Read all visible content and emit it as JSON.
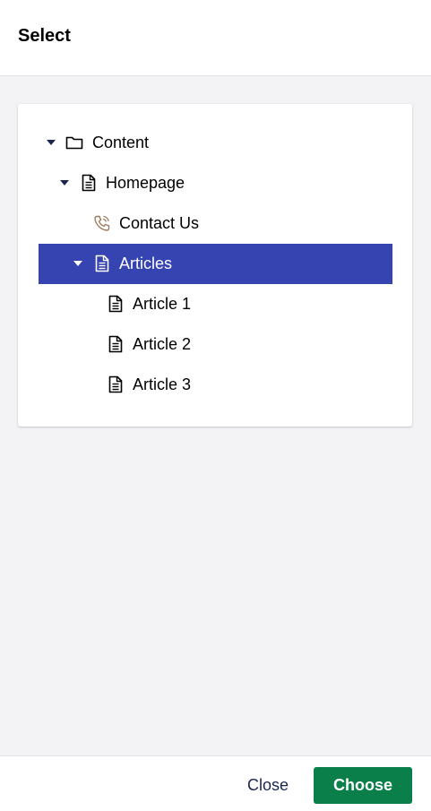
{
  "header": {
    "title": "Select"
  },
  "tree": {
    "items": [
      {
        "label": "Content",
        "icon": "folder-icon",
        "expanded": true,
        "selected": false
      },
      {
        "label": "Homepage",
        "icon": "document-icon",
        "expanded": true,
        "selected": false
      },
      {
        "label": "Contact Us",
        "icon": "phone-icon",
        "expanded": false,
        "selected": false
      },
      {
        "label": "Articles",
        "icon": "document-icon",
        "expanded": true,
        "selected": true
      },
      {
        "label": "Article 1",
        "icon": "document-icon",
        "expanded": false,
        "selected": false
      },
      {
        "label": "Article 2",
        "icon": "document-icon",
        "expanded": false,
        "selected": false
      },
      {
        "label": "Article 3",
        "icon": "document-icon",
        "expanded": false,
        "selected": false
      }
    ]
  },
  "footer": {
    "close_label": "Close",
    "choose_label": "Choose"
  },
  "colors": {
    "selected_row": "#3544b1",
    "choose_button": "#0a7f4a",
    "phone_icon": "#9b7b5c",
    "text_dark": "#1b264f"
  }
}
